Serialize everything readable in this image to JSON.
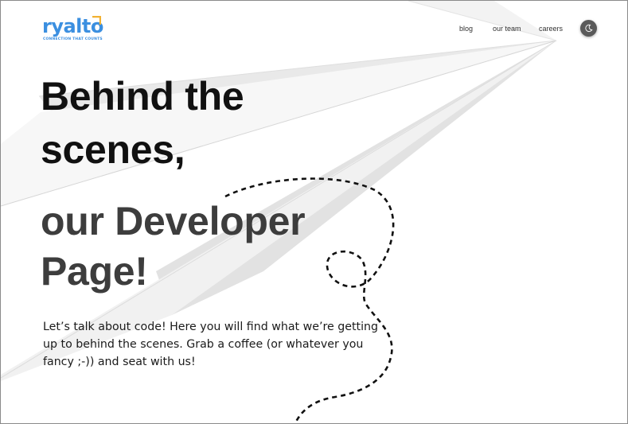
{
  "brand": {
    "name": "ryalto",
    "tagline": "CONNECTION THAT COUNTS",
    "colors": {
      "primary": "#3b8fe0",
      "accent": "#f2b233"
    }
  },
  "nav": {
    "items": [
      "blog",
      "our team",
      "careers"
    ],
    "theme_toggle_icon": "moon-icon"
  },
  "hero": {
    "title_lines": [
      "Behind the",
      "scenes,"
    ],
    "subtitle_lines": [
      "our Developer",
      "Page!"
    ],
    "intro_lines": [
      "Let’s talk about code! Here you will find what we’re getting",
      "up to behind the scenes. Grab a coffee (or whatever you",
      "fancy ;-)) and seat with us!"
    ]
  },
  "decorations": {
    "paper_plane_icon": "paper-plane-illustration",
    "flight_path_icon": "dashed-flight-path"
  }
}
